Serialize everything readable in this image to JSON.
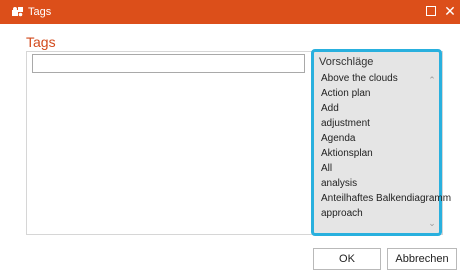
{
  "window": {
    "title": "Tags",
    "app_icon": "tags-puzzle-icon",
    "maximize_icon": "maximize-icon",
    "close_symbol": "✕",
    "accent_color": "#dc4f1a"
  },
  "section": {
    "title": "Tags"
  },
  "tag_input": {
    "value": "",
    "placeholder": ""
  },
  "suggestions": {
    "header": "Vorschläge",
    "border_color": "#29b0de",
    "items": [
      "Above the clouds",
      "Action plan",
      "Add",
      "adjustment",
      "Agenda",
      "Aktionsplan",
      "All",
      "analysis",
      "Anteilhaftes Balkendiagramm",
      "approach"
    ],
    "scroll_up_icon": "chevron-up-icon",
    "scroll_down_icon": "chevron-down-icon"
  },
  "buttons": {
    "ok": "OK",
    "cancel": "Abbrechen"
  }
}
